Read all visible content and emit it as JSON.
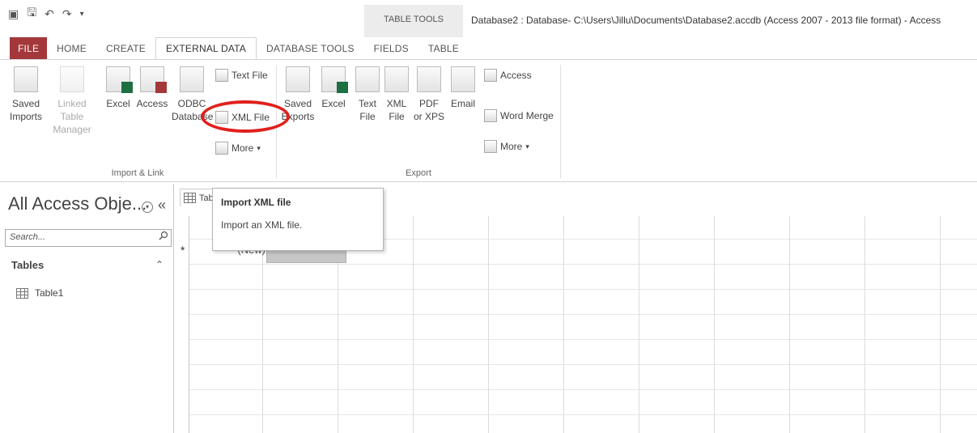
{
  "window": {
    "title": "Database2 : Database- C:\\Users\\Jillu\\Documents\\Database2.accdb (Access 2007 - 2013 file format) - Access",
    "context_tab_group": "TABLE TOOLS"
  },
  "tabs": [
    "FILE",
    "HOME",
    "CREATE",
    "EXTERNAL DATA",
    "DATABASE TOOLS",
    "FIELDS",
    "TABLE"
  ],
  "active_tab": "EXTERNAL DATA",
  "ribbon": {
    "import_group": {
      "label": "Import & Link",
      "saved_imports": [
        "Saved",
        "Imports"
      ],
      "linked_table_manager": [
        "Linked Table",
        "Manager"
      ],
      "excel": "Excel",
      "access": "Access",
      "odbc": [
        "ODBC",
        "Database"
      ],
      "text_file": "Text File",
      "xml_file": "XML File",
      "more": "More"
    },
    "export_group": {
      "label": "Export",
      "saved_exports": [
        "Saved",
        "Exports"
      ],
      "excel": "Excel",
      "text_file": [
        "Text",
        "File"
      ],
      "xml_file": [
        "XML",
        "File"
      ],
      "pdf_xps": [
        "PDF",
        "or XPS"
      ],
      "email": "Email",
      "access": "Access",
      "word_merge": "Word Merge",
      "more": "More"
    }
  },
  "nav": {
    "title": "All Access Obje...",
    "search_placeholder": "Search...",
    "category": "Tables",
    "items": [
      "Table1"
    ]
  },
  "document": {
    "tab_label": "Tab",
    "new_row_marker": "*",
    "new_row_text": "(New)"
  },
  "tooltip": {
    "title": "Import XML file",
    "description": "Import an XML file."
  }
}
